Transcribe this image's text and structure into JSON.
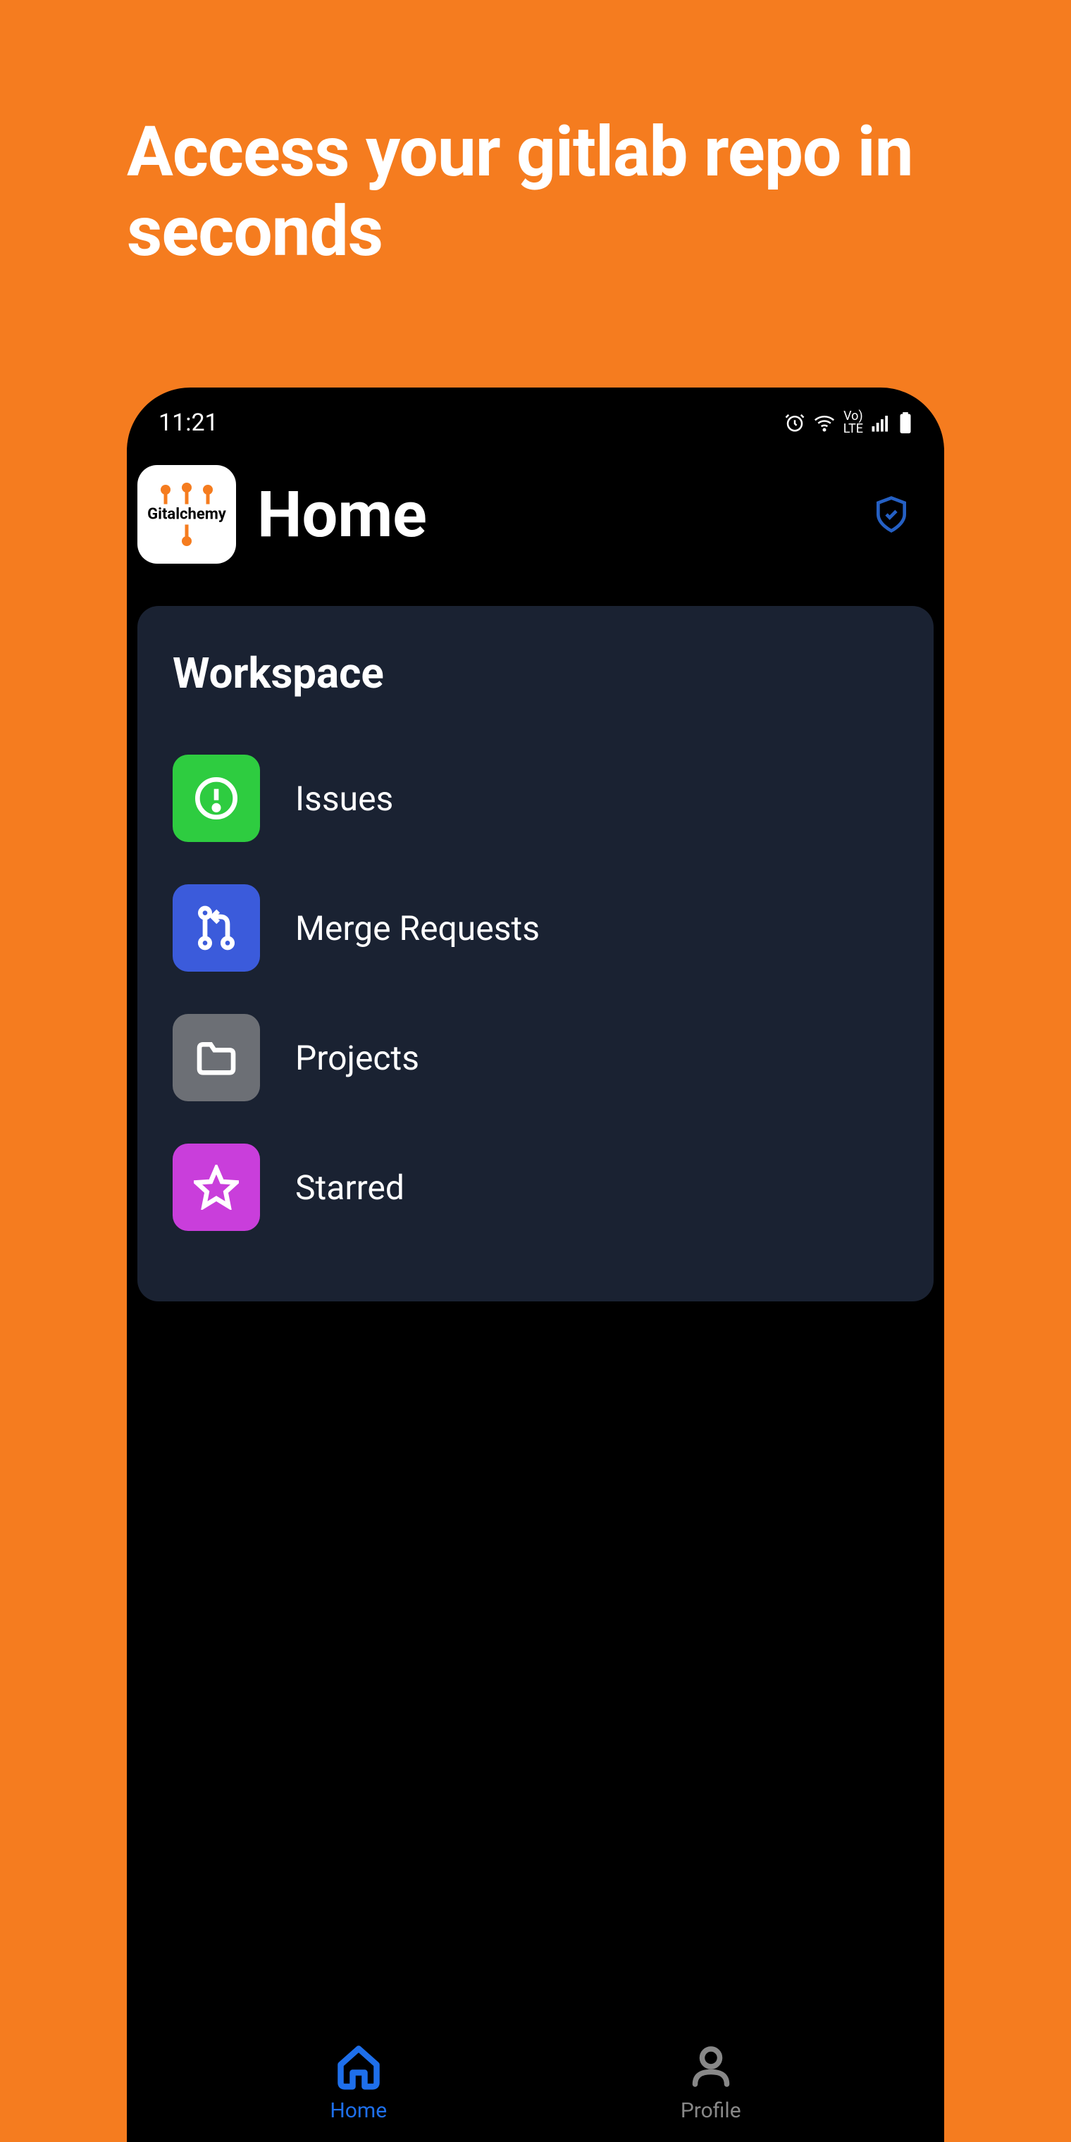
{
  "promo": {
    "headline": "Access your gitlab repo in seconds"
  },
  "statusBar": {
    "time": "11:21",
    "networkLabel": "LTE",
    "voLabel": "Vo)"
  },
  "header": {
    "logoText": "Gitalchemy",
    "title": "Home"
  },
  "workspace": {
    "title": "Workspace",
    "items": [
      {
        "label": "Issues",
        "iconName": "alert-circle-icon",
        "colorClass": "icon-green"
      },
      {
        "label": "Merge Requests",
        "iconName": "merge-icon",
        "colorClass": "icon-blue"
      },
      {
        "label": "Projects",
        "iconName": "folder-icon",
        "colorClass": "icon-gray"
      },
      {
        "label": "Starred",
        "iconName": "star-icon",
        "colorClass": "icon-purple"
      }
    ]
  },
  "bottomNav": {
    "items": [
      {
        "label": "Home",
        "iconName": "home-icon",
        "active": true
      },
      {
        "label": "Profile",
        "iconName": "profile-icon",
        "active": false
      }
    ]
  }
}
